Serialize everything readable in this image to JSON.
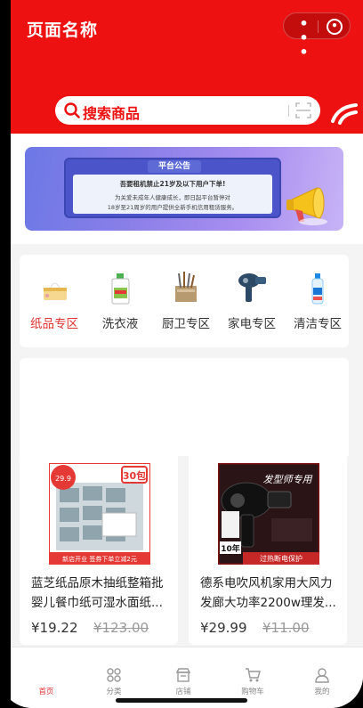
{
  "header": {
    "page_title": "页面名称",
    "search_placeholder": "搜索商品",
    "accent_color": "#ee1111"
  },
  "banner": {
    "title": "平台公告",
    "headline": "吾要租机禁止21岁及以下用户下单!",
    "line1": "为关爱未成年人健康成长，即日起平台暂停对",
    "line2": "18岁至21周岁的用户提供全新手机信用租赁服务。",
    "pages": 3,
    "active_page": 1
  },
  "categories": [
    {
      "label": "纸品专区",
      "icon": "tissue-box-icon",
      "active": true
    },
    {
      "label": "洗衣液",
      "icon": "detergent-bottle-icon",
      "active": false
    },
    {
      "label": "厨卫专区",
      "icon": "kitchen-tools-icon",
      "active": false
    },
    {
      "label": "家电专区",
      "icon": "hair-dryer-icon",
      "active": false
    },
    {
      "label": "清洁专区",
      "icon": "cleaner-bottle-icon",
      "active": false
    }
  ],
  "products": [
    {
      "name": "蓝芝纸品原木抽纸整箱批婴儿餐巾纸可湿水面纸...",
      "price": "¥19.22",
      "old_price": "¥123.00",
      "img_badge": "30包",
      "img_promo": "新店开业 签券下单立减2元",
      "img_tag": "29.9"
    },
    {
      "name": "德系电吹风机家用大风力发廊大功率2200w理发...",
      "price": "¥29.99",
      "old_price": "¥11.00",
      "img_title": "发型师专用",
      "img_tag": "10年",
      "img_promo": "过热断电保护"
    }
  ],
  "tabbar": [
    {
      "label": "首页",
      "icon": "home-icon",
      "active": true
    },
    {
      "label": "分类",
      "icon": "category-grid-icon",
      "active": false
    },
    {
      "label": "店铺",
      "icon": "shop-icon",
      "active": false
    },
    {
      "label": "购物车",
      "icon": "cart-icon",
      "active": false
    },
    {
      "label": "我的",
      "icon": "user-icon",
      "active": false
    }
  ]
}
